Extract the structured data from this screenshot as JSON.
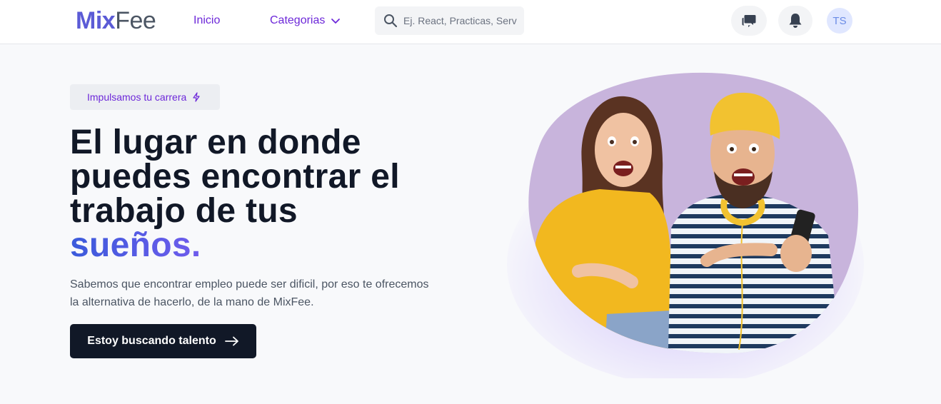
{
  "header": {
    "logo": {
      "part1": "Mix",
      "part2": "Fee"
    },
    "nav": {
      "inicio": "Inicio",
      "categorias": "Categorias"
    },
    "search": {
      "placeholder": "Ej. React, Practicas, Serv",
      "value": ""
    },
    "icons": {
      "chat": "chat-bubbles-icon",
      "notifications": "bell-icon",
      "search": "search-icon",
      "dropdown": "chevron-down-icon"
    },
    "avatar_initials": "TS"
  },
  "hero": {
    "badge": "Impulsamos tu carrera",
    "badge_icon": "lightning-icon",
    "headline": {
      "line1": "El lugar en donde",
      "line2": "puedes encontrar el",
      "line3": "trabajo de tus",
      "highlight": "sueños."
    },
    "subtext_line1": "Sabemos que encontrar empleo puede ser dificil, por eso te ofrecemos",
    "subtext_line2": "la alternativa de hacerlo, de la mano de MixFee.",
    "cta_label": "Estoy buscando talento",
    "cta_icon": "arrow-right-icon"
  },
  "colors": {
    "brand": "#5b5bd6",
    "accent": "#6d28d9",
    "dark": "#111827",
    "blob": "#c8b4dc"
  }
}
